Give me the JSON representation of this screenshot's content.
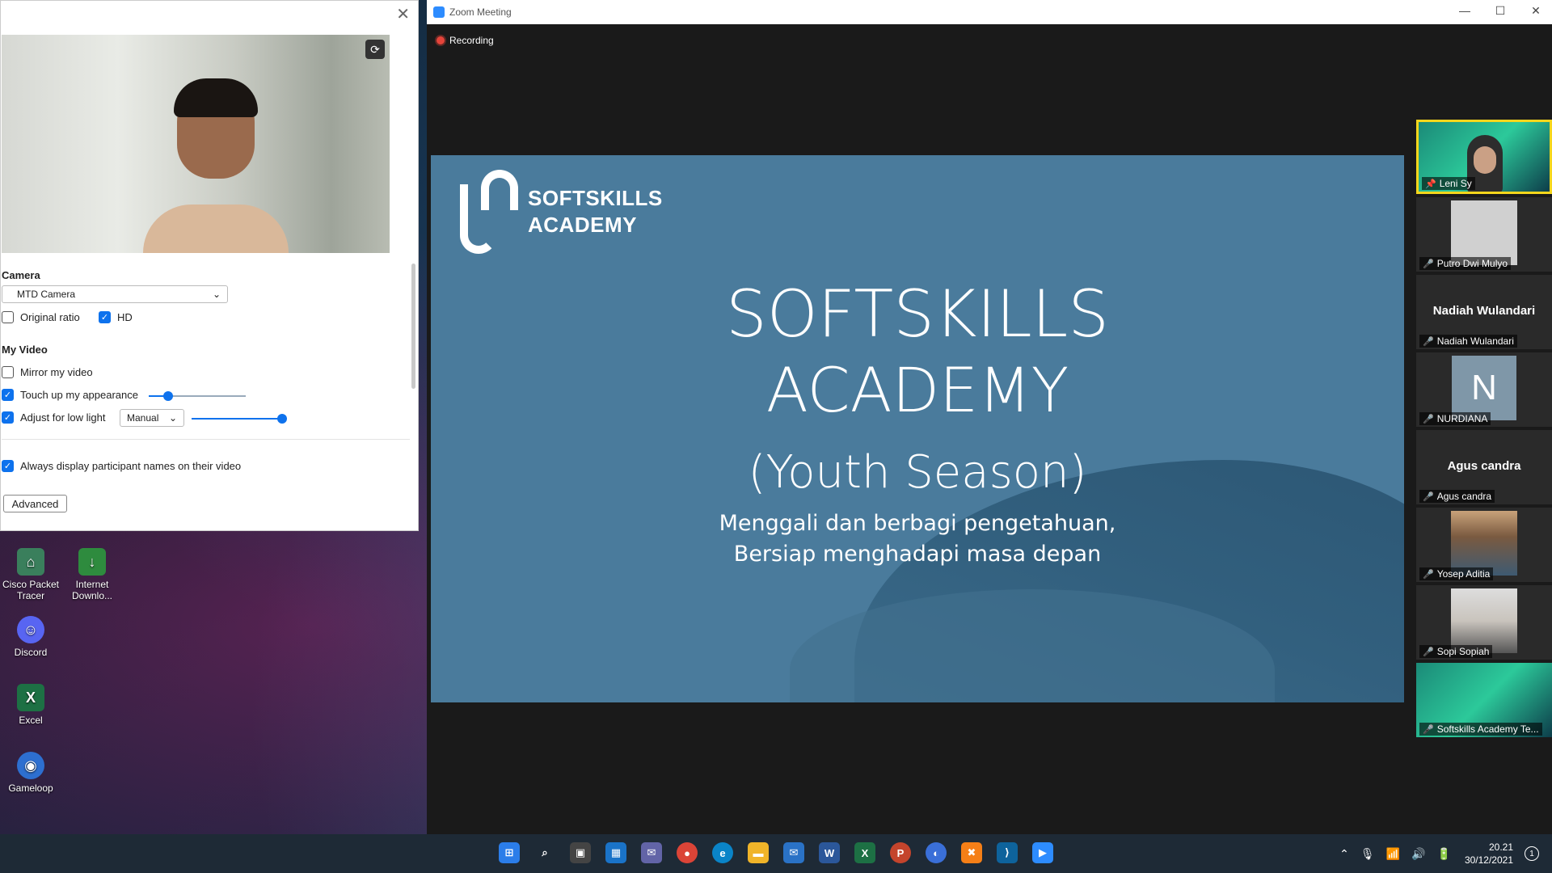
{
  "desktop": {
    "icons": [
      {
        "label": "Cisco Packet Tracer",
        "icon": "cisco-packet-tracer-icon"
      },
      {
        "label": "Internet Downlo...",
        "icon": "internet-download-manager-icon"
      },
      {
        "label": "Discord",
        "icon": "discord-icon"
      },
      {
        "label": "Excel",
        "icon": "excel-icon"
      },
      {
        "label": "Gameloop",
        "icon": "gameloop-icon"
      }
    ]
  },
  "settings": {
    "camera_section": "Camera",
    "camera_value": "MTD Camera",
    "original_ratio": "Original ratio",
    "hd": "HD",
    "my_video_section": "My Video",
    "mirror": "Mirror my video",
    "touch_up": "Touch up my appearance",
    "touch_up_level": 0.2,
    "adjust_low_light": "Adjust for low light",
    "low_light_mode": "Manual",
    "low_light_level": 1.0,
    "always_display_names": "Always display participant names on their video",
    "advanced_label": "Advanced",
    "checkboxes": {
      "original_ratio": false,
      "hd": true,
      "mirror": false,
      "touch_up": true,
      "adjust_low_light": true,
      "always_display_names": true
    }
  },
  "zoom": {
    "window_title": "Zoom Meeting",
    "recording_label": "Recording",
    "slide": {
      "brand_line1": "SOFTSKILLS",
      "brand_line2": "ACADEMY",
      "title_line1": "SOFTSKILLS",
      "title_line2": "ACADEMY",
      "title_line3": "(Youth Season)",
      "subtitle_line1": "Menggali dan berbagi pengetahuan,",
      "subtitle_line2": "Bersiap menghadapi masa depan"
    },
    "participants": [
      {
        "name": "Leni Sy",
        "type": "video-green",
        "pinned": true,
        "active": true
      },
      {
        "name": "Putro Dwi Mulyo",
        "type": "photo-grey"
      },
      {
        "name": "Nadiah Wulandari",
        "type": "name-only"
      },
      {
        "name": "NURDIANA",
        "type": "letter",
        "letter": "N"
      },
      {
        "name": "Agus candra",
        "type": "name-only"
      },
      {
        "name": "Yosep Aditia",
        "type": "photo"
      },
      {
        "name": "Sopi Sopiah",
        "type": "photo"
      },
      {
        "name": "Softskills Academy Te...",
        "type": "video-green"
      }
    ]
  },
  "taskbar": {
    "apps": [
      "windows-start-icon",
      "search-icon",
      "task-view-icon",
      "widgets-icon",
      "teams-chat-icon",
      "chrome-icon",
      "edge-icon",
      "file-explorer-icon",
      "mail-icon",
      "word-icon",
      "excel-icon",
      "powerpoint-icon",
      "network-app-icon",
      "xampp-icon",
      "vscode-icon",
      "zoom-icon"
    ],
    "time": "20.21",
    "date": "30/12/2021",
    "notification_count": "1"
  }
}
